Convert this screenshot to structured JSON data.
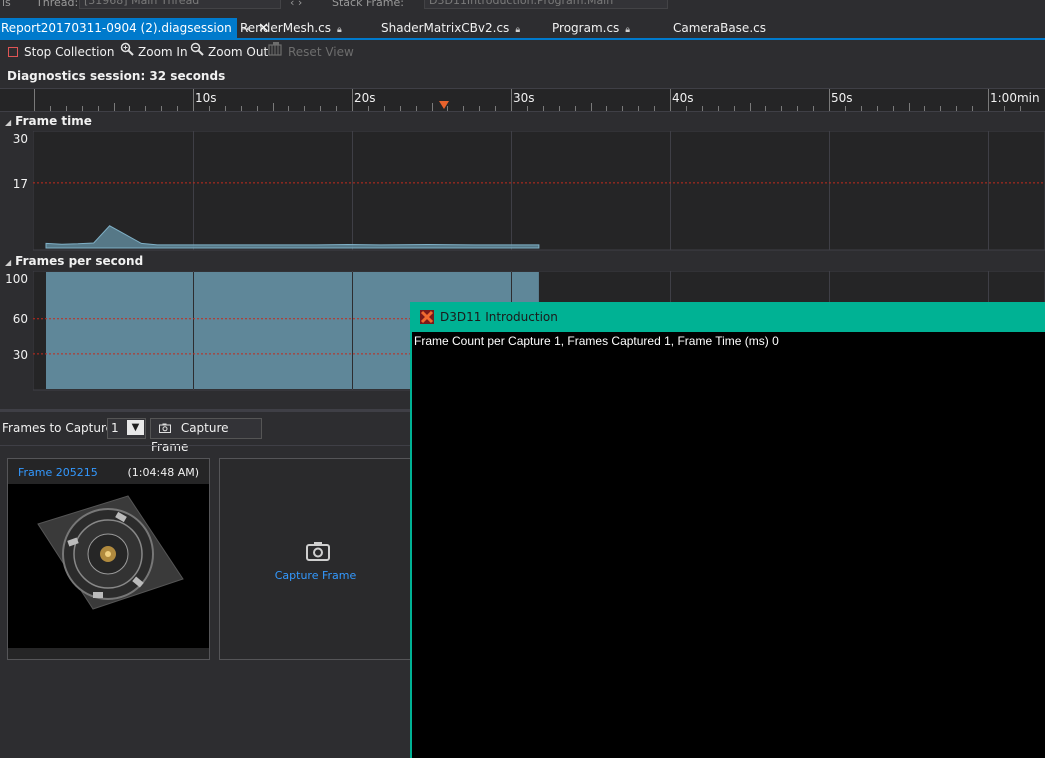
{
  "top_strip": {
    "left_label": "ls",
    "thread_label": "Thread:",
    "thread_value": "[31968] Main Thread",
    "stack_label": "Stack Frame:",
    "stack_value": "D3D11Introduction.Program.Main"
  },
  "tabs": [
    {
      "label": "Report20170311-0904 (2).diagsession",
      "active": true
    },
    {
      "label": "RenderMesh.cs",
      "active": false
    },
    {
      "label": "ShaderMatrixCBv2.cs",
      "active": false
    },
    {
      "label": "Program.cs",
      "active": false
    },
    {
      "label": "CameraBase.cs",
      "active": false
    }
  ],
  "toolbar": {
    "stop": "Stop Collection",
    "zoom_in": "Zoom In",
    "zoom_out": "Zoom Out",
    "reset": "Reset View"
  },
  "session_label": "Diagnostics session: 32 seconds",
  "ruler": {
    "labels": [
      "10s",
      "20s",
      "30s",
      "40s",
      "50s",
      "1:00min"
    ]
  },
  "frame_time": {
    "title": "Frame time",
    "ticks": [
      "30",
      "17"
    ],
    "chart_data": {
      "type": "area",
      "x": [
        1,
        2,
        3,
        4,
        5,
        6,
        7,
        8,
        10,
        12,
        15,
        18,
        20,
        22,
        25,
        28,
        30,
        32
      ],
      "y": [
        1.2,
        1.0,
        1.1,
        1.3,
        5.8,
        3.5,
        1.2,
        0.8,
        0.8,
        0.8,
        0.8,
        0.8,
        0.9,
        0.8,
        0.9,
        0.8,
        0.8,
        0.8
      ],
      "threshold": 17,
      "ylim": [
        0,
        30
      ]
    }
  },
  "fps": {
    "title": "Frames per second",
    "ticks": [
      "100",
      "60",
      "30"
    ],
    "chart_data": {
      "type": "area",
      "x": [
        1,
        32
      ],
      "y": [
        100,
        100
      ],
      "thresholds": [
        60,
        30
      ],
      "ylim": [
        0,
        100
      ]
    }
  },
  "capture": {
    "label": "Frames to Capture:",
    "count": "1",
    "button": "Capture Frame"
  },
  "thumbnail": {
    "title": "Frame 205215",
    "time": "(1:04:48 AM)"
  },
  "capture_card": {
    "label": "Capture Frame"
  },
  "d3d_window": {
    "title": "D3D11 Introduction",
    "text": "Frame Count per Capture 1, Frames Captured 1, Frame Time (ms) 0"
  },
  "colors": {
    "accent": "#007acc",
    "window_title": "#00b294",
    "threshold": "#c42b1c",
    "series": "#5f8799"
  }
}
